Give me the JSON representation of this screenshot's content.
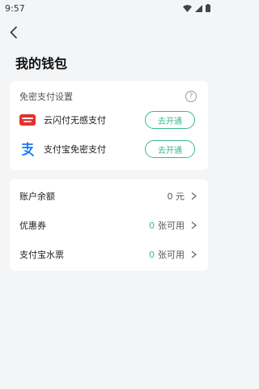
{
  "status": {
    "time": "9:57"
  },
  "page": {
    "title": "我的钱包"
  },
  "payment_settings": {
    "header": "免密支付设置",
    "help_glyph": "?",
    "items": [
      {
        "label": "云闪付无感支付",
        "button": "去开通",
        "icon": "unionpay-icon",
        "brand_color": "#e2322d"
      },
      {
        "label": "支付宝免密支付",
        "button": "去开通",
        "icon": "alipay-icon",
        "brand_color": "#1677ff"
      }
    ]
  },
  "wallet_items": {
    "balance": {
      "label": "账户余额",
      "value": "0 元"
    },
    "coupons": {
      "label": "优惠券",
      "count": "0",
      "suffix": "张可用"
    },
    "alipay_tickets": {
      "label": "支付宝水票",
      "count": "0",
      "suffix": "张可用"
    }
  },
  "colors": {
    "accent": "#39b98f",
    "background": "#f4f5f7"
  }
}
